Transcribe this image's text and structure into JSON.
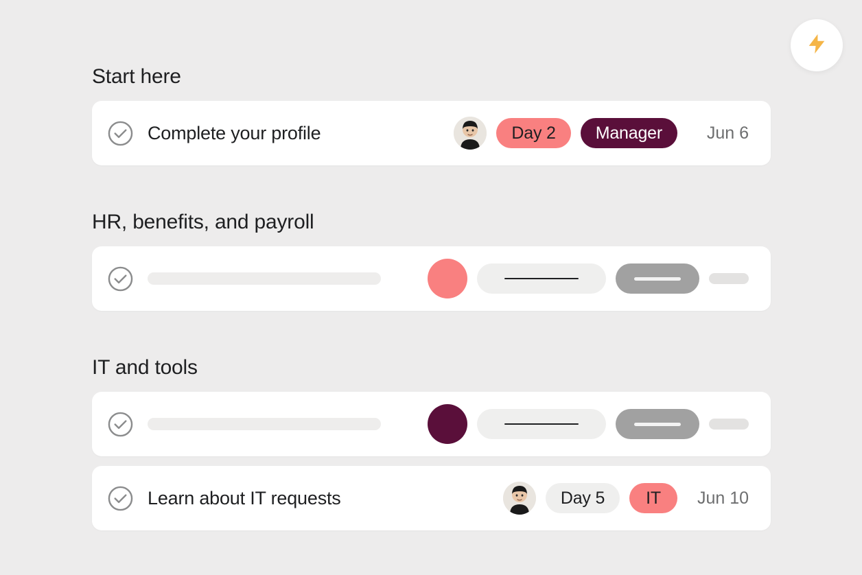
{
  "sections": {
    "start": {
      "title": "Start here",
      "task": {
        "title": "Complete your profile",
        "tag1": "Day 2",
        "tag2": "Manager",
        "date": "Jun 6"
      }
    },
    "hr": {
      "title": "HR, benefits, and payroll"
    },
    "it": {
      "title": "IT and tools",
      "task": {
        "title": "Learn about IT requests",
        "tag1": "Day 5",
        "tag2": "IT",
        "date": "Jun 10"
      }
    }
  },
  "colors": {
    "coral": "#f98080",
    "maroon": "#5a0f3a",
    "grey_pill": "#a1a1a1",
    "light_pill": "#efefee",
    "background": "#edecec"
  },
  "icons": {
    "check": "check-circle-icon",
    "lightning": "lightning-icon",
    "avatar": "person-avatar"
  }
}
